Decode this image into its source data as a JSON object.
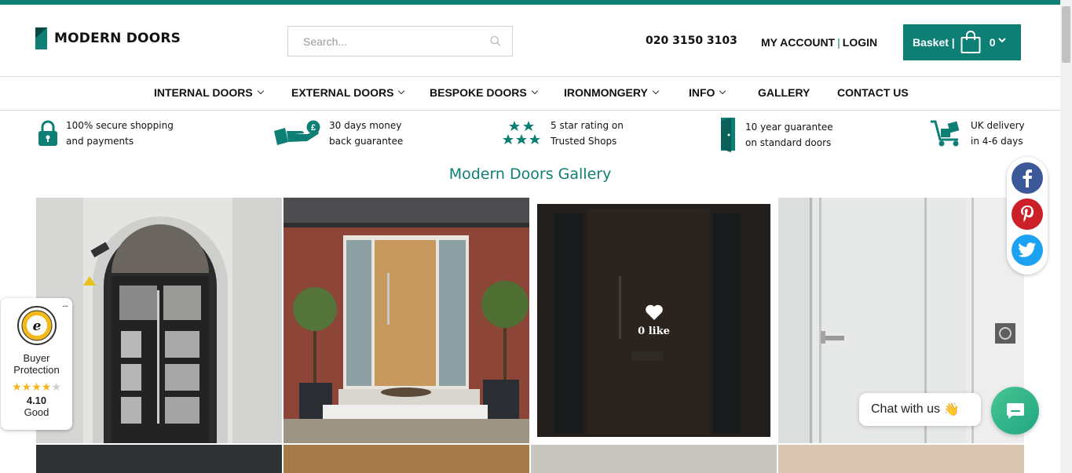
{
  "header": {
    "logo_text": "MODERN DOORS",
    "search_placeholder": "Search...",
    "phone": "020 3150 3103",
    "my_account": "MY ACCOUNT",
    "separator": "|",
    "login": "LOGIN",
    "basket_label": "Basket |",
    "basket_count": "0"
  },
  "nav": {
    "items": [
      {
        "label": "INTERNAL DOORS",
        "dropdown": true
      },
      {
        "label": "EXTERNAL DOORS",
        "dropdown": true
      },
      {
        "label": "BESPOKE DOORS",
        "dropdown": true
      },
      {
        "label": "IRONMONGERY",
        "dropdown": true
      },
      {
        "label": "INFO",
        "dropdown": true
      },
      {
        "label": "GALLERY",
        "dropdown": false
      },
      {
        "label": "CONTACT US",
        "dropdown": false
      }
    ]
  },
  "usps": [
    {
      "icon": "padlock-icon",
      "line1": "100% secure shopping",
      "line2": "and payments"
    },
    {
      "icon": "money-hand-icon",
      "line1": "30 days money",
      "line2": "back guarantee"
    },
    {
      "icon": "stars-icon",
      "line1": "5 star rating on",
      "line2": "Trusted Shops"
    },
    {
      "icon": "door-icon",
      "line1": "10 year guarantee",
      "line2": "on standard doors"
    },
    {
      "icon": "delivery-trolley-icon",
      "line1": "UK delivery",
      "line2": "in 4-6 days"
    }
  ],
  "gallery": {
    "title": "Modern Doors Gallery",
    "like_label": "0 like"
  },
  "trusted_shops": {
    "line1": "Buyer",
    "line2": "Protection",
    "score": "4.10",
    "rating_word": "Good",
    "stars_filled": 4,
    "stars_total": 5,
    "menu": "..."
  },
  "social": [
    "facebook-icon",
    "pinterest-icon",
    "twitter-icon"
  ],
  "chat": {
    "label": "Chat with us",
    "emoji": "👋"
  },
  "colors": {
    "brand": "#0e7f74",
    "facebook": "#3b5998",
    "pinterest": "#cb2027",
    "twitter": "#1da1f2"
  }
}
